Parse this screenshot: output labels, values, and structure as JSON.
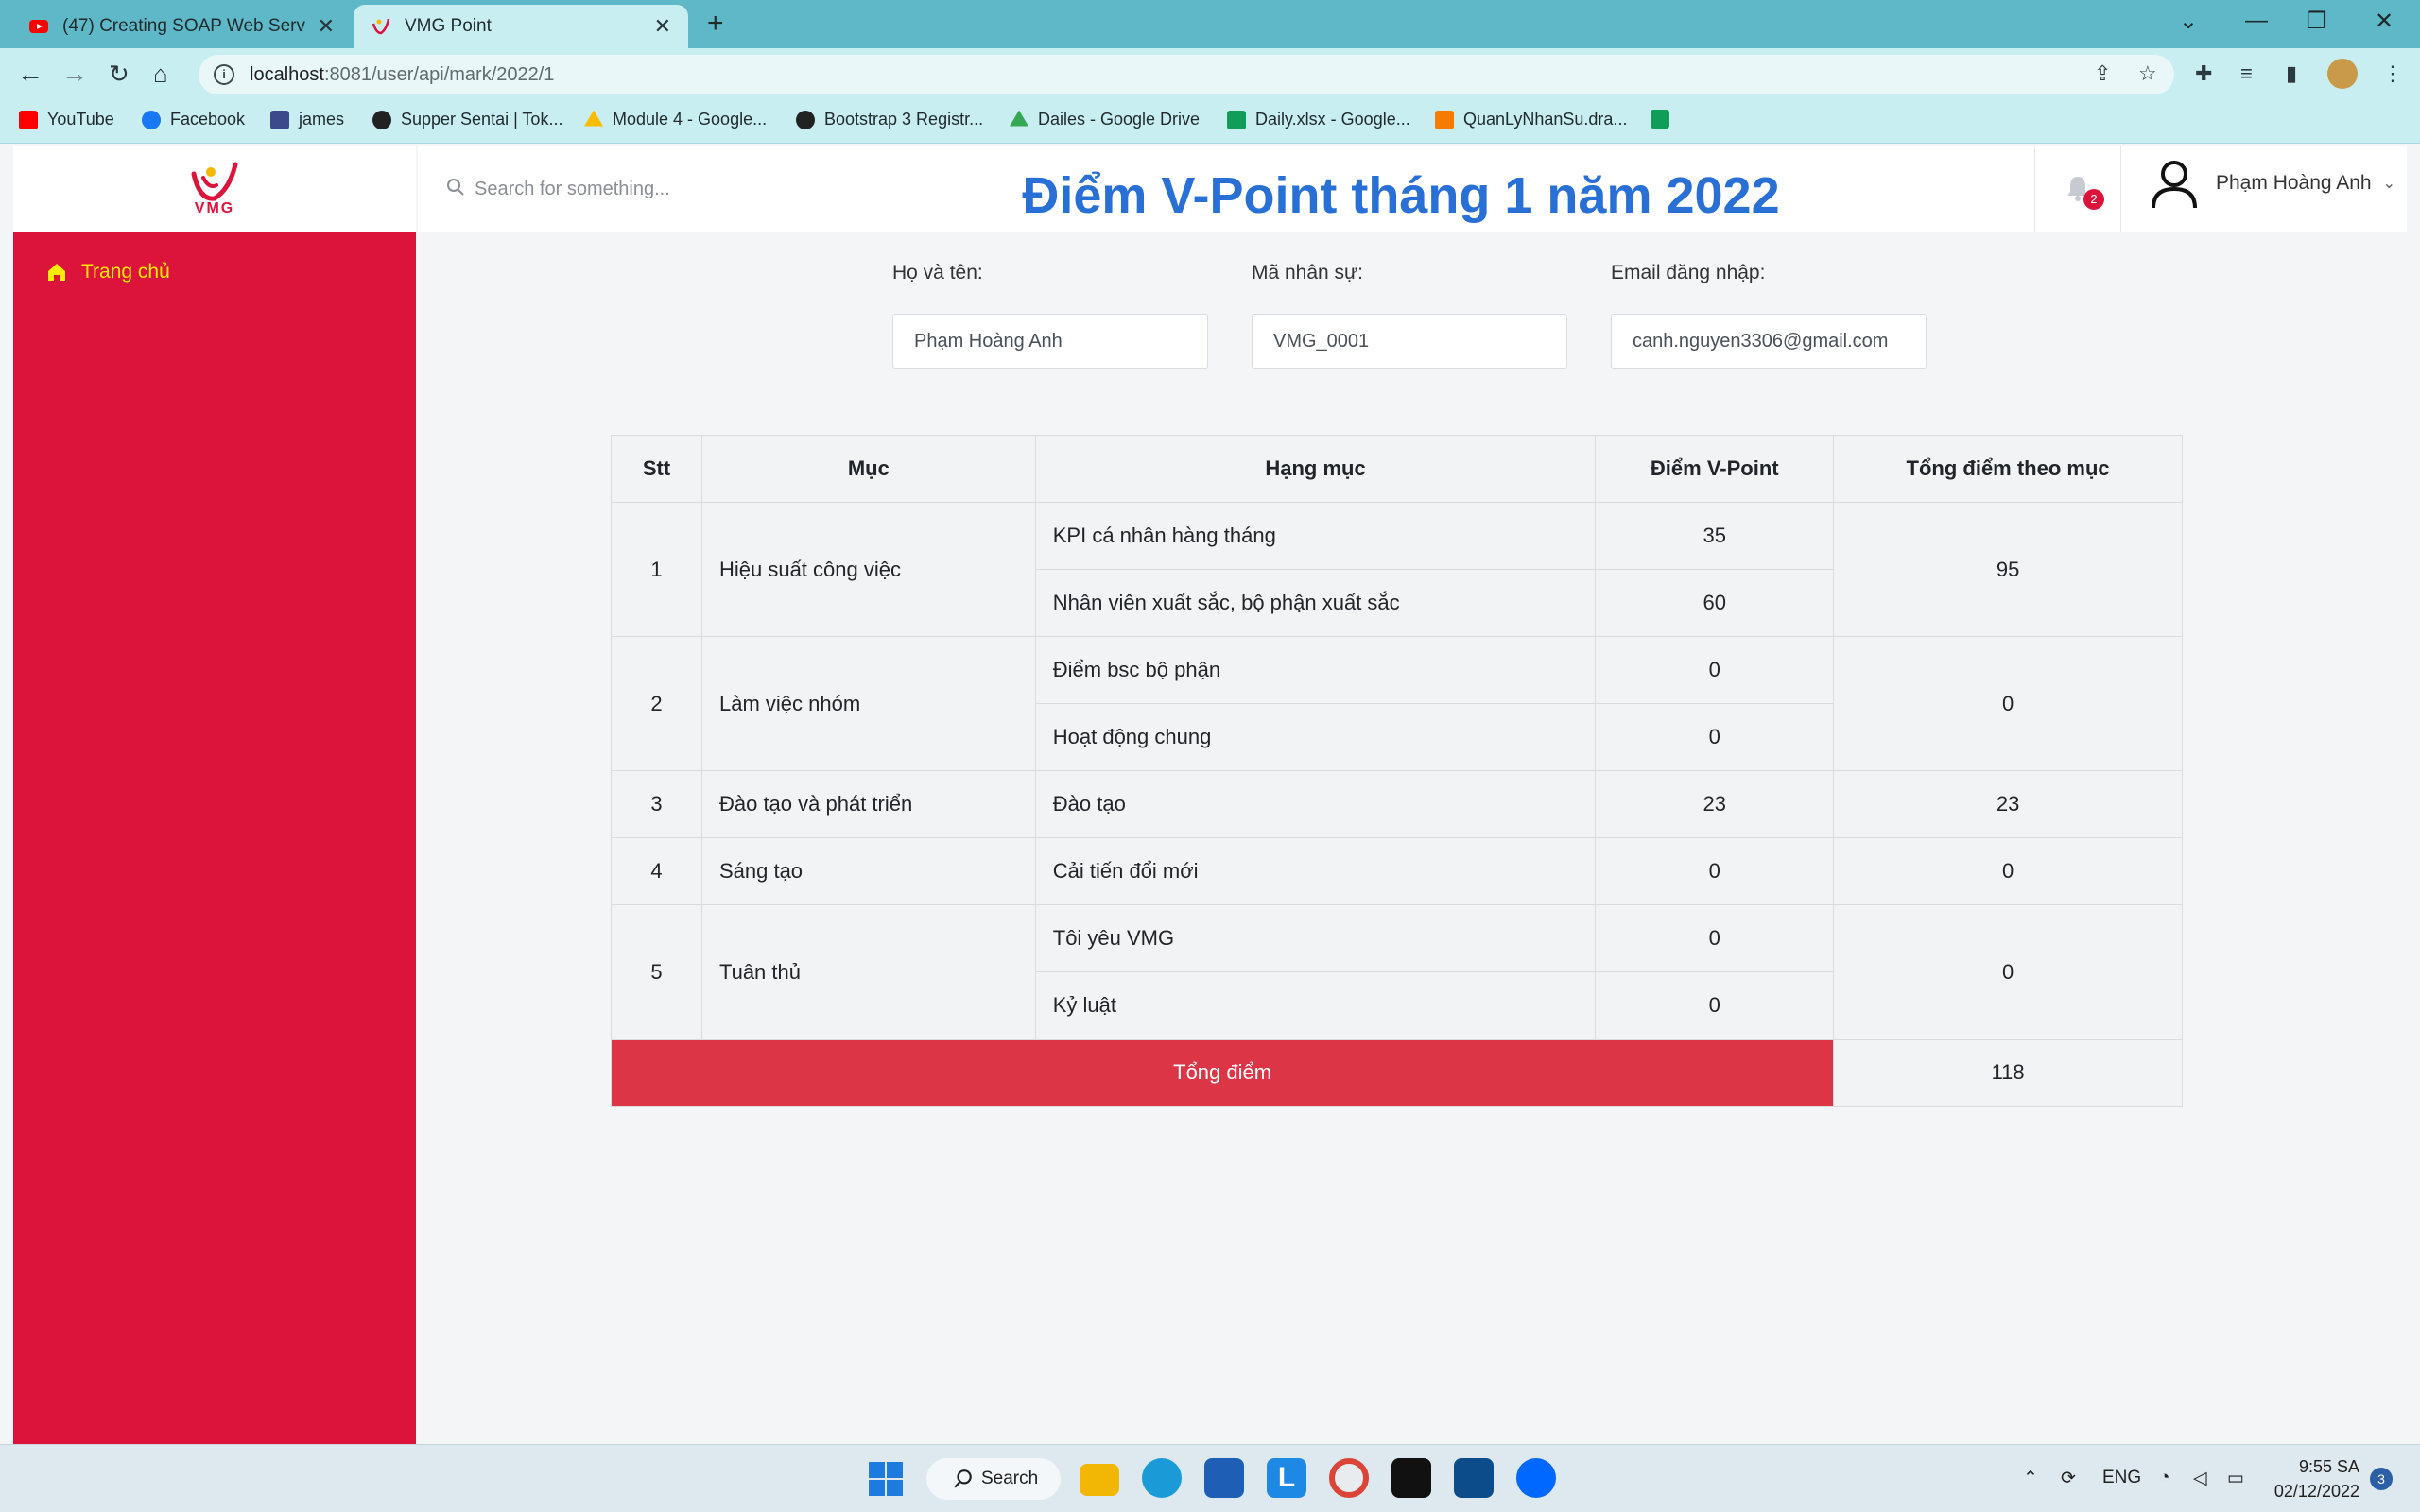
{
  "browser": {
    "tabs": [
      {
        "title": "(47) Creating SOAP Web Service",
        "close": "✕"
      },
      {
        "title": "VMG Point",
        "close": "✕"
      }
    ],
    "new_tab": "+",
    "url_host": "localhost",
    "url_rest": ":8081/user/api/mark/2022/1",
    "bookmarks": [
      {
        "label": "YouTube",
        "color": "#ff0000"
      },
      {
        "label": "Facebook",
        "color": "#1877f2"
      },
      {
        "label": "james",
        "color": "#3c4a8c"
      },
      {
        "label": "Supper Sentai | Tok...",
        "color": "#222222"
      },
      {
        "label": "Module 4 - Google...",
        "color": "#fbbc04"
      },
      {
        "label": "Bootstrap 3 Registr...",
        "color": "#222222"
      },
      {
        "label": "Dailes - Google Drive",
        "color": "#34a853"
      },
      {
        "label": "Daily.xlsx - Google...",
        "color": "#0f9d58"
      },
      {
        "label": "QuanLyNhanSu.dra...",
        "color": "#f57c00"
      },
      {
        "label": "",
        "color": "#0f9d58"
      }
    ]
  },
  "app": {
    "logo_text": "VMG",
    "sidebar": {
      "home_label": "Trang chủ"
    },
    "search_placeholder": "Search for something...",
    "notification_count": "2",
    "user_name": "Phạm Hoàng Anh",
    "page_title": "Điểm V-Point tháng 1 năm 2022",
    "fields": {
      "name_label": "Họ và tên:",
      "name_value": "Phạm Hoàng Anh",
      "staff_label": "Mã nhân sự:",
      "staff_value": "VMG_0001",
      "email_label": "Email đăng nhập:",
      "email_value": "canh.nguyen3306@gmail.com"
    },
    "table": {
      "headers": [
        "Stt",
        "Mục",
        "Hạng mục",
        "Điểm V-Point",
        "Tổng điểm theo mục"
      ],
      "groups": [
        {
          "stt": "1",
          "muc": "Hiệu suất công việc",
          "total": "95",
          "items": [
            {
              "name": "KPI cá nhân hàng tháng",
              "points": "35"
            },
            {
              "name": "Nhân viên xuất sắc, bộ phận xuất sắc",
              "points": "60"
            }
          ]
        },
        {
          "stt": "2",
          "muc": "Làm việc nhóm",
          "total": "0",
          "items": [
            {
              "name": "Điểm bsc bộ phận",
              "points": "0"
            },
            {
              "name": "Hoạt động chung",
              "points": "0"
            }
          ]
        },
        {
          "stt": "3",
          "muc": "Đào tạo và phát triển",
          "total": "23",
          "items": [
            {
              "name": "Đào tạo",
              "points": "23"
            }
          ]
        },
        {
          "stt": "4",
          "muc": "Sáng tạo",
          "total": "0",
          "items": [
            {
              "name": "Cải tiến đổi mới",
              "points": "0"
            }
          ]
        },
        {
          "stt": "5",
          "muc": "Tuân thủ",
          "total": "0",
          "items": [
            {
              "name": "Tôi yêu VMG",
              "points": "0"
            },
            {
              "name": "Kỷ luật",
              "points": "0"
            }
          ]
        }
      ],
      "total_label": "Tổng điểm",
      "total_value": "118"
    }
  },
  "taskbar": {
    "search_label": "Search",
    "language": "ENG",
    "time": "9:55 SA",
    "date": "02/12/2022",
    "notification_count": "3"
  },
  "colors": {
    "sidebar": "#dc143c",
    "title": "#2970d6",
    "total_row": "#dc3545",
    "home_link": "#ffea00"
  }
}
